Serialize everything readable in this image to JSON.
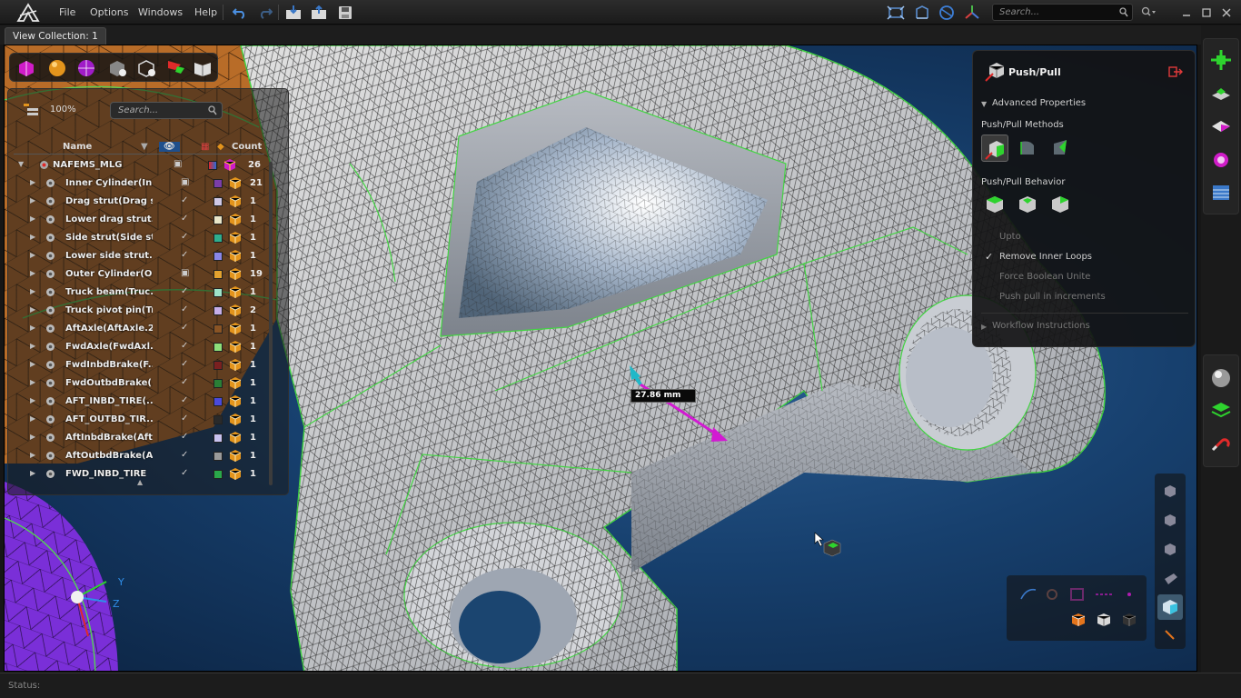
{
  "menubar": {
    "items": [
      "File",
      "Options",
      "Windows",
      "Help"
    ],
    "search_placeholder": "Search..."
  },
  "tabs": {
    "active": "View Collection: 1"
  },
  "browser": {
    "zoom": "100%",
    "search_placeholder": "Search...",
    "columns": {
      "name": "Name",
      "count": "Count"
    },
    "root": {
      "name": "NAFEMS_MLG",
      "count": "26"
    },
    "rows": [
      {
        "name": "Inner Cylinder(In...",
        "color": "#7b3ea8",
        "count": "21"
      },
      {
        "name": "Drag strut(Drag s...",
        "color": "#cfc8e6",
        "count": "1"
      },
      {
        "name": "Lower drag strut...",
        "color": "#e9e6c9",
        "count": "1"
      },
      {
        "name": "Side strut(Side st...",
        "color": "#2fae8e",
        "count": "1"
      },
      {
        "name": "Lower side strut...",
        "color": "#8a86e8",
        "count": "1"
      },
      {
        "name": "Outer Cylinder(O...",
        "color": "#e3a22e",
        "count": "19"
      },
      {
        "name": "Truck beam(Truc...",
        "color": "#9ee3c9",
        "count": "1"
      },
      {
        "name": "Truck pivot pin(Tr...",
        "color": "#c6aee8",
        "count": "2"
      },
      {
        "name": "AftAxle(AftAxle.2)",
        "color": "#8a5424",
        "count": "1"
      },
      {
        "name": "FwdAxle(FwdAxl...",
        "color": "#8de07a",
        "count": "1"
      },
      {
        "name": "FwdInbdBrake(F...",
        "color": "#7a2020",
        "count": "1"
      },
      {
        "name": "FwdOutbdBrake(...",
        "color": "#2a7f36",
        "count": "1"
      },
      {
        "name": "AFT_INBD_TIRE(...",
        "color": "#4a4adb",
        "count": "1"
      },
      {
        "name": "AFT_OUTBD_TIR...",
        "color": "#2a2a2a",
        "count": "1"
      },
      {
        "name": "AftInbdBrake(Aftl...",
        "color": "#c9c2ef",
        "count": "1"
      },
      {
        "name": "AftOutbdBrake(A...",
        "color": "#9a9a9a",
        "count": "1"
      },
      {
        "name": "FWD_INBD_TIRE",
        "color": "#2aa84a",
        "count": "1"
      }
    ]
  },
  "pushpull": {
    "title": "Push/Pull",
    "advanced": "Advanced Properties",
    "methods_label": "Push/Pull Methods",
    "behavior_label": "Push/Pull Behavior",
    "options": [
      {
        "label": "Upto",
        "checked": false
      },
      {
        "label": "Remove Inner Loops",
        "checked": true
      },
      {
        "label": "Force Boolean Unite",
        "checked": false
      },
      {
        "label": "Push pull in increments",
        "checked": false
      }
    ],
    "check_glyph": "✓",
    "workflow": "Workflow Instructions"
  },
  "viewport": {
    "dimension": "27.86 mm",
    "axes": {
      "y": "Y",
      "z": "Z"
    }
  },
  "status": {
    "label": "Status:"
  }
}
